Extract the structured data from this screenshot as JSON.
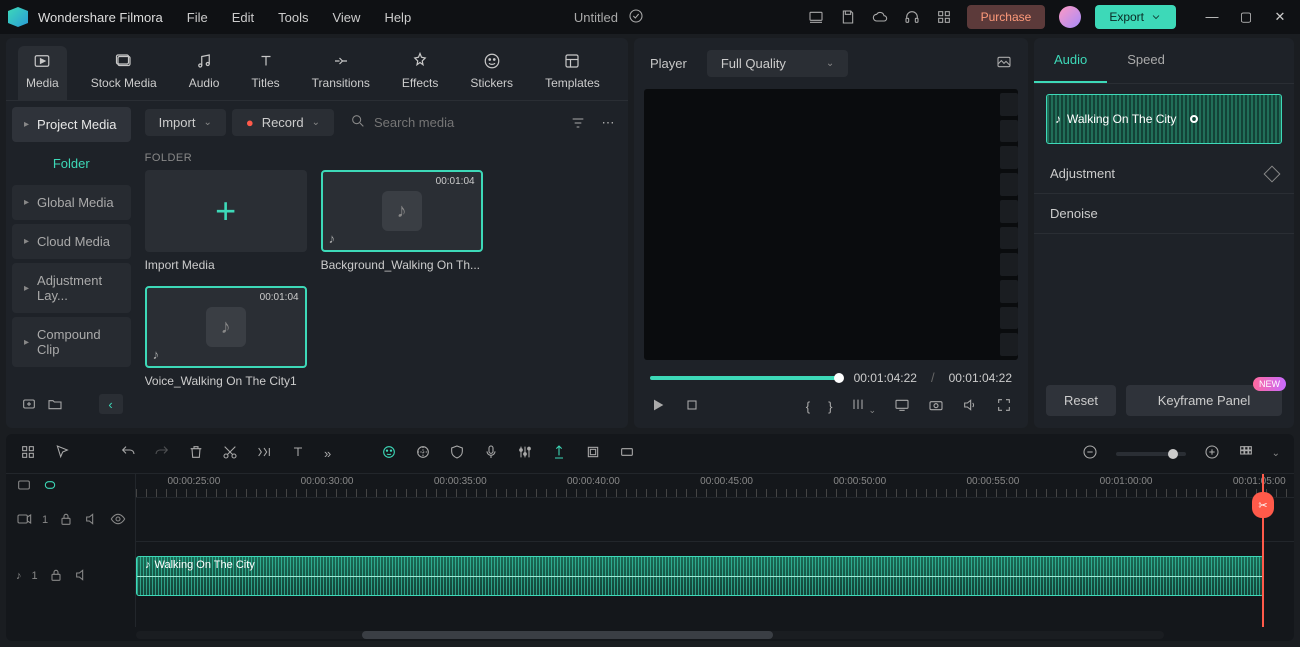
{
  "app": {
    "name": "Wondershare Filmora",
    "title": "Untitled"
  },
  "menu": [
    "File",
    "Edit",
    "Tools",
    "View",
    "Help"
  ],
  "actions": {
    "purchase": "Purchase",
    "export": "Export"
  },
  "tabs": [
    {
      "label": "Media"
    },
    {
      "label": "Stock Media"
    },
    {
      "label": "Audio"
    },
    {
      "label": "Titles"
    },
    {
      "label": "Transitions"
    },
    {
      "label": "Effects"
    },
    {
      "label": "Stickers"
    },
    {
      "label": "Templates"
    }
  ],
  "sidebar": {
    "items": [
      {
        "label": "Project Media"
      },
      {
        "label": "Folder"
      },
      {
        "label": "Global Media"
      },
      {
        "label": "Cloud Media"
      },
      {
        "label": "Adjustment Lay..."
      },
      {
        "label": "Compound Clip"
      }
    ]
  },
  "mediaToolbar": {
    "import": "Import",
    "record": "Record",
    "search_placeholder": "Search media",
    "folder_label": "FOLDER"
  },
  "mediaItems": [
    {
      "name": "Import Media",
      "duration": ""
    },
    {
      "name": "Background_Walking On Th...",
      "duration": "00:01:04"
    },
    {
      "name": "Voice_Walking On The City1",
      "duration": "00:01:04"
    }
  ],
  "player": {
    "label": "Player",
    "quality": "Full Quality",
    "current": "00:01:04:22",
    "total": "00:01:04:22"
  },
  "inspector": {
    "tabs": [
      "Audio",
      "Speed"
    ],
    "clip_name": "Walking On The City",
    "sections": {
      "adjustment": "Adjustment",
      "denoise": "Denoise"
    },
    "reset": "Reset",
    "keyframe": "Keyframe Panel",
    "new_badge": "NEW"
  },
  "timeline": {
    "ticks": [
      "00:00:25:00",
      "00:00:30:00",
      "00:00:35:00",
      "00:00:40:00",
      "00:00:45:00",
      "00:00:50:00",
      "00:00:55:00",
      "00:01:00:00",
      "00:01:05:00"
    ],
    "video_track": "1",
    "audio_track": "1",
    "audio_clip": "Walking On The City"
  }
}
